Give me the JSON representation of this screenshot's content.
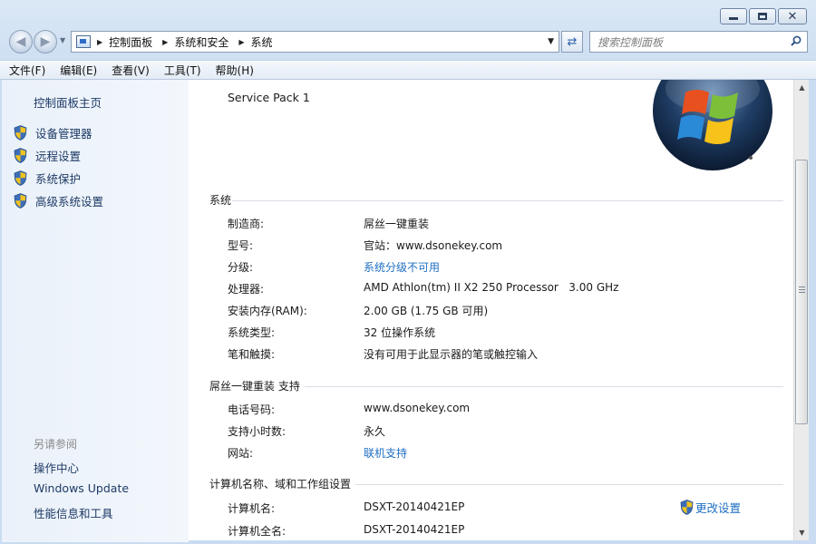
{
  "window": {
    "buttons": {
      "minimize": "—",
      "maximize": "□",
      "close": "✕"
    }
  },
  "nav": {
    "back_icon": "back-arrow-icon",
    "forward_icon": "forward-arrow-icon",
    "breadcrumbs": [
      "控制面板",
      "系统和安全",
      "系统"
    ],
    "search_placeholder": "搜索控制面板"
  },
  "menubar": {
    "items": [
      "文件(F)",
      "编辑(E)",
      "查看(V)",
      "工具(T)",
      "帮助(H)"
    ]
  },
  "sidebar": {
    "home": "控制面板主页",
    "items": [
      "设备管理器",
      "远程设置",
      "系统保护",
      "高级系统设置"
    ],
    "see_also_title": "另请参阅",
    "see_also": [
      "操作中心",
      "Windows Update",
      "性能信息和工具"
    ]
  },
  "edition": {
    "service_pack": "Service Pack 1"
  },
  "system": {
    "title": "系统",
    "rows": [
      {
        "label": "制造商:",
        "value": "屌丝一键重装"
      },
      {
        "label": "型号:",
        "value": "官站：www.dsonekey.com"
      },
      {
        "label": "分级:",
        "value": "系统分级不可用"
      },
      {
        "label": "处理器:",
        "value": "AMD Athlon(tm) II X2 250 Processor   3.00 GHz"
      },
      {
        "label": "安装内存(RAM):",
        "value": "2.00 GB (1.75 GB 可用)"
      },
      {
        "label": "系统类型:",
        "value": "32 位操作系统"
      },
      {
        "label": "笔和触摸:",
        "value": "没有可用于此显示器的笔或触控输入"
      }
    ]
  },
  "support": {
    "title": "屌丝一键重装 支持",
    "rows": [
      {
        "label": "电话号码:",
        "value": "www.dsonekey.com"
      },
      {
        "label": "支持小时数:",
        "value": "永久"
      },
      {
        "label": "网站:",
        "value": "联机支持"
      }
    ]
  },
  "computer": {
    "title": "计算机名称、域和工作组设置",
    "rows": [
      {
        "label": "计算机名:",
        "value": "DSXT-20140421EP"
      },
      {
        "label": "计算机全名:",
        "value": "DSXT-20140421EP"
      }
    ],
    "change_settings": "更改设置"
  },
  "colors": {
    "link": "#1f6fc2",
    "sidebar_link": "#1e3a65",
    "muted": "#8a8a8a"
  }
}
